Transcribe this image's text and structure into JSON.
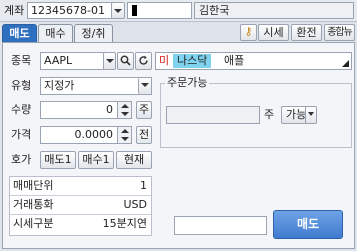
{
  "account": {
    "label": "계좌",
    "number": "12345678-01",
    "owner": "김한국"
  },
  "tabs": [
    {
      "label": "매도",
      "active": true
    },
    {
      "label": "매수",
      "active": false
    },
    {
      "label": "정/취",
      "active": false
    }
  ],
  "toolbar": {
    "key_icon": "key-icon",
    "price_label": "시세",
    "exchange_label": "환전",
    "news_label": "종합뉴스"
  },
  "form": {
    "symbol_label": "종목",
    "symbol_value": "AAPL",
    "market_flag": "미",
    "exchange": "나스닥",
    "stock_name": "애플",
    "type_label": "유형",
    "type_value": "지정가",
    "qty_label": "수량",
    "qty_value": "0",
    "qty_button": "주",
    "price_label": "가격",
    "price_value": "0.0000",
    "price_button": "전",
    "quote_label": "호가",
    "sell1_label": "매도1",
    "buy1_label": "매수1",
    "current_label": "현재"
  },
  "orderable": {
    "title": "주문가능",
    "value": "",
    "unit": "주",
    "button_label": "가능"
  },
  "info": [
    {
      "label": "매매단위",
      "value": "1"
    },
    {
      "label": "거래통화",
      "value": "USD"
    },
    {
      "label": "시세구분",
      "value": "15분지연"
    }
  ],
  "submit": {
    "password_value": "",
    "sell_label": "매도"
  },
  "colors": {
    "sell_button": "#4a86d8",
    "active_tab": "#2f6fbf",
    "market_flag": "#d81b1b",
    "exchange_bg": "#7fd3ee"
  }
}
